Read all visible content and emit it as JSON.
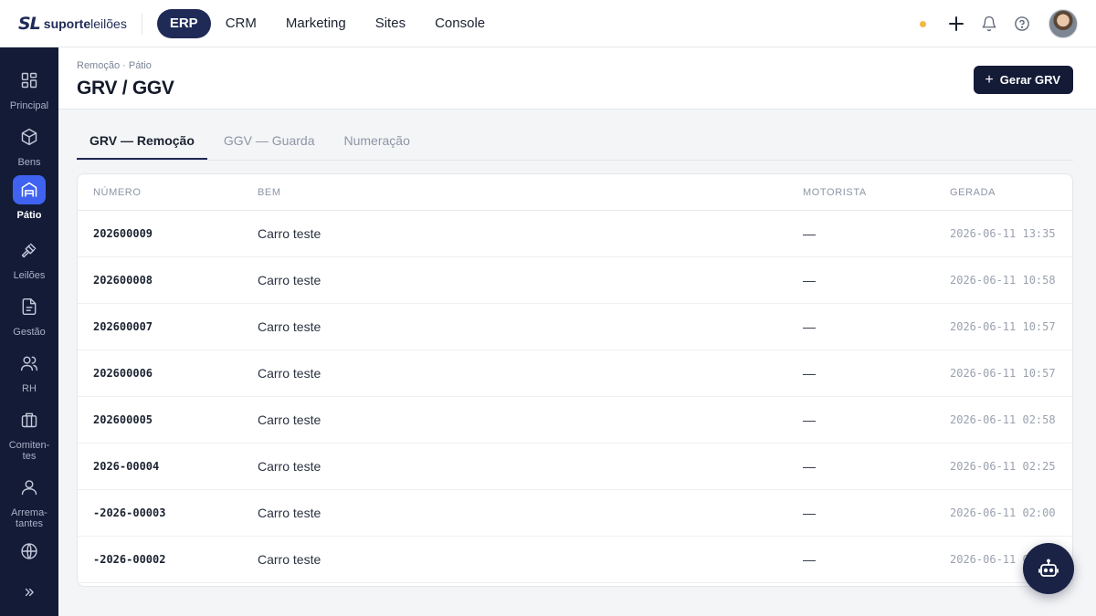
{
  "app": {
    "logo_mark": "SL",
    "logo_name_bold": "suporte",
    "logo_name_regular": "leilões"
  },
  "topnav": {
    "items": [
      {
        "label": "ERP",
        "active": true
      },
      {
        "label": "CRM",
        "active": false
      },
      {
        "label": "Marketing",
        "active": false
      },
      {
        "label": "Sites",
        "active": false
      },
      {
        "label": "Console",
        "active": false
      }
    ],
    "icons": [
      "status-dot",
      "plus-icon",
      "bell-icon",
      "help-icon",
      "avatar"
    ]
  },
  "sidebar": {
    "items": [
      {
        "label": "Principal",
        "icon": "grid-icon",
        "active": false
      },
      {
        "label": "Bens",
        "icon": "box-icon",
        "active": false
      },
      {
        "label": "Pátio",
        "icon": "warehouse-icon",
        "active": true
      },
      {
        "label": "Leilões",
        "icon": "gavel-icon",
        "active": false
      },
      {
        "label": "Gestão",
        "icon": "document-icon",
        "active": false
      },
      {
        "label": "RH",
        "icon": "users-icon",
        "active": false
      },
      {
        "label": "Comiten-\ntes",
        "icon": "briefcase-icon",
        "active": false
      },
      {
        "label": "Arrema-\ntantes",
        "icon": "user-icon",
        "active": false
      },
      {
        "label": "",
        "icon": "globe-icon",
        "active": false
      }
    ],
    "collapse_icon": "chevrons-right-icon"
  },
  "header": {
    "breadcrumb": "Remoção · Pátio",
    "title": "GRV / GGV",
    "primary_button": {
      "icon": "+",
      "label": "Gerar GRV"
    }
  },
  "tabs": [
    {
      "label": "GRV — Remoção",
      "active": true
    },
    {
      "label": "GGV — Guarda",
      "active": false
    },
    {
      "label": "Numeração",
      "active": false
    }
  ],
  "table": {
    "columns": [
      "NÚMERO",
      "BEM",
      "MOTORISTA",
      "GERADA"
    ],
    "rows": [
      {
        "numero": "202600009",
        "bem": "Carro teste",
        "motorista": "—",
        "gerada": "2026-06-11 13:35"
      },
      {
        "numero": "202600008",
        "bem": "Carro teste",
        "motorista": "—",
        "gerada": "2026-06-11 10:58"
      },
      {
        "numero": "202600007",
        "bem": "Carro teste",
        "motorista": "—",
        "gerada": "2026-06-11 10:57"
      },
      {
        "numero": "202600006",
        "bem": "Carro teste",
        "motorista": "—",
        "gerada": "2026-06-11 10:57"
      },
      {
        "numero": "202600005",
        "bem": "Carro teste",
        "motorista": "—",
        "gerada": "2026-06-11 02:58"
      },
      {
        "numero": "2026-00004",
        "bem": "Carro teste",
        "motorista": "—",
        "gerada": "2026-06-11 02:25"
      },
      {
        "numero": "-2026-00003",
        "bem": "Carro teste",
        "motorista": "—",
        "gerada": "2026-06-11 02:00"
      },
      {
        "numero": "-2026-00002",
        "bem": "Carro teste",
        "motorista": "—",
        "gerada": "2026-06-11 0"
      }
    ]
  },
  "colors": {
    "brand_navy": "#1f2a56",
    "sidebar_bg": "#141b37",
    "active_blue": "#3f63f0",
    "status_dot": "#f5b841"
  },
  "fab": {
    "icon": "robot-icon"
  }
}
